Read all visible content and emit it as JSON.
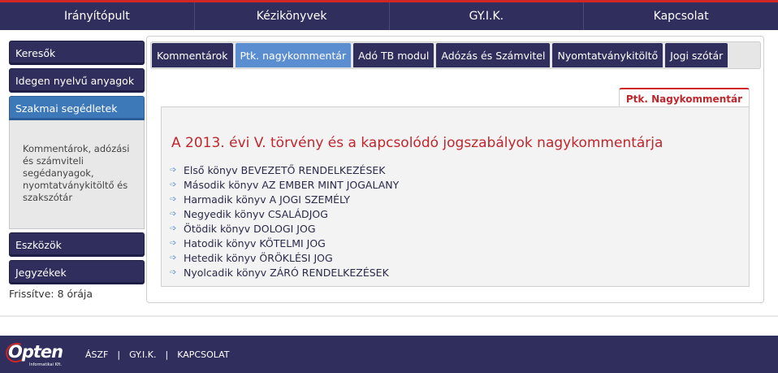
{
  "topnav": {
    "items": [
      {
        "label": "Irányítópult"
      },
      {
        "label": "Kézikönyvek"
      },
      {
        "label": "GY.I.K."
      },
      {
        "label": "Kapcsolat"
      }
    ]
  },
  "sidebar": {
    "items": [
      {
        "label": "Keresők"
      },
      {
        "label": "Idegen nyelvű anyagok"
      },
      {
        "label": "Szakmai segédletek"
      },
      {
        "label": "Eszközök"
      },
      {
        "label": "Jegyzékek"
      }
    ],
    "panel_text": "Kommentárok, adózási és számviteli segédanyagok, nyomtatványkitöltő és szakszótár",
    "updated": "Frissítve: 8 órája"
  },
  "main": {
    "tabs": [
      {
        "label": "Kommentárok"
      },
      {
        "label": "Ptk. nagykommentár"
      },
      {
        "label": "Adó TB modul"
      },
      {
        "label": "Adózás és Számvitel"
      },
      {
        "label": "Nyomtatványkitöltő"
      },
      {
        "label": "Jogi szótár"
      }
    ],
    "content_tab": "Ptk. Nagykommentár",
    "title": "A 2013. évi V. törvény és a kapcsolódó jogszabályok nagykommentárja",
    "books": [
      {
        "label": "Első könyv BEVEZETŐ RENDELKEZÉSEK"
      },
      {
        "label": "Második könyv AZ EMBER MINT JOGALANY"
      },
      {
        "label": "Harmadik könyv A JOGI SZEMÉLY"
      },
      {
        "label": "Negyedik könyv CSALÁDJOG"
      },
      {
        "label": "Ötödik könyv DOLOGI JOG"
      },
      {
        "label": "Hatodik könyv KÖTELMI JOG"
      },
      {
        "label": "Hetedik könyv ÖRÖKLÉSI JOG"
      },
      {
        "label": "Nyolcadik könyv ZÁRÓ RENDELKEZÉSEK"
      }
    ]
  },
  "footer": {
    "logo_text": "Opten",
    "logo_sub": "Informatikai Kft.",
    "links": [
      {
        "label": "ÁSZF"
      },
      {
        "label": "GY.I.K."
      },
      {
        "label": "KAPCSOLAT"
      }
    ],
    "separator": "|"
  },
  "colors": {
    "nav_bg": "#2f2e5c",
    "accent_red": "#d02626",
    "active_tab": "#5b8ed1",
    "active_sidebar": "#3d78b8",
    "title_red": "#c0272d"
  }
}
